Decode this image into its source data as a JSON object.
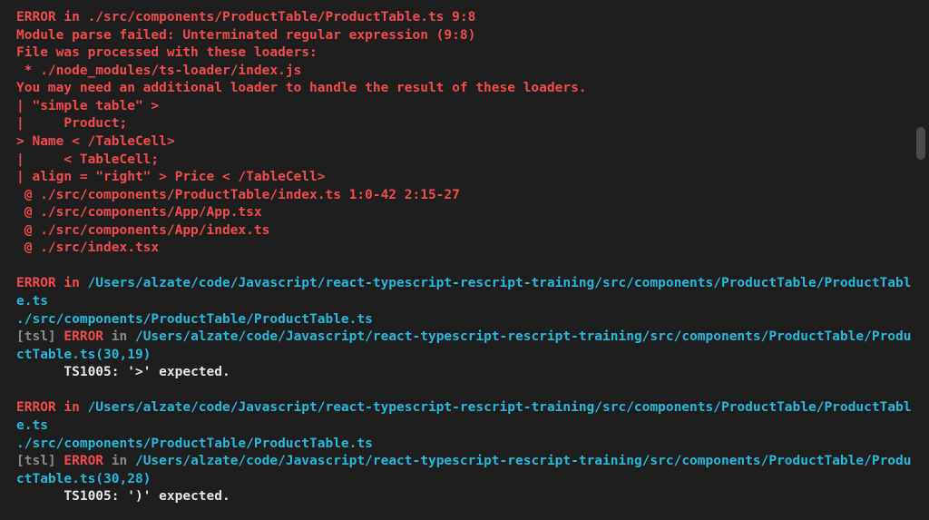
{
  "block1": {
    "l1": "ERROR in ./src/components/ProductTable/ProductTable.ts 9:8",
    "l2": "Module parse failed: Unterminated regular expression (9:8)",
    "l3": "File was processed with these loaders:",
    "l4": " * ./node_modules/ts-loader/index.js",
    "l5": "You may need an additional loader to handle the result of these loaders.",
    "l6": "| \"simple table\" >",
    "l7": "|     Product;",
    "l8": "> Name < /TableCell>",
    "l9": "|     < TableCell;",
    "l10": "| align = \"right\" > Price < /TableCell>",
    "l11": " @ ./src/components/ProductTable/index.ts 1:0-42 2:15-27",
    "l12": " @ ./src/components/App/App.tsx",
    "l13": " @ ./src/components/App/index.ts",
    "l14": " @ ./src/index.tsx"
  },
  "block2": {
    "l1a": "ERROR in ",
    "l1b": "/Users/alzate/code/Javascript/react-typescript-rescript-training/src/components/ProductTable/ProductTable.ts",
    "l2": "./src/components/ProductTable/ProductTable.ts",
    "l3a": "[tsl] ",
    "l3b": "ERROR",
    "l3c": " in ",
    "l3d": "/Users/alzate/code/Javascript/react-typescript-rescript-training/src/components/ProductTable/ProductTable.ts(30,19)",
    "l4": "      TS1005: '>' expected."
  },
  "block3": {
    "l1a": "ERROR in ",
    "l1b": "/Users/alzate/code/Javascript/react-typescript-rescript-training/src/components/ProductTable/ProductTable.ts",
    "l2": "./src/components/ProductTable/ProductTable.ts",
    "l3a": "[tsl] ",
    "l3b": "ERROR",
    "l3c": " in ",
    "l3d": "/Users/alzate/code/Javascript/react-typescript-rescript-training/src/components/ProductTable/ProductTable.ts(30,28)",
    "l4": "      TS1005: ')' expected."
  }
}
